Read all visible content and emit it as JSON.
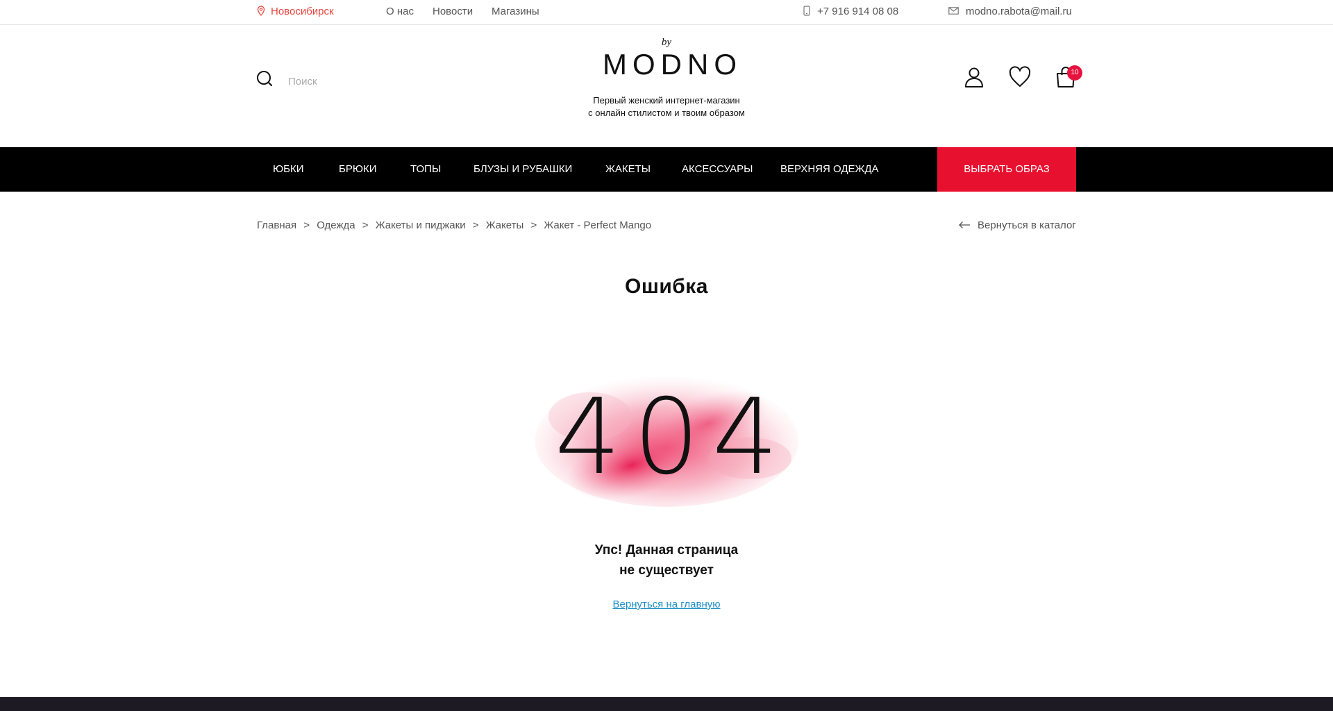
{
  "topbar": {
    "city": "Новосибирск",
    "links": [
      "О нас",
      "Новости",
      "Магазины"
    ],
    "phone": "+7 916 914 08 08",
    "email": "modno.rabota@mail.ru"
  },
  "header": {
    "search_placeholder": "Поиск",
    "logo_by": "by",
    "logo_brand": "MODNO",
    "tagline_line1": "Первый женский интернет-магазин",
    "tagline_line2": "с онлайн стилистом и твоим образом",
    "cart_count": "10"
  },
  "nav": {
    "items": [
      "ЮБКИ",
      "БРЮКИ",
      "ТОПЫ",
      "БЛУЗЫ И РУБАШКИ",
      "ЖАКЕТЫ",
      "АКСЕССУАРЫ",
      "ВЕРХНЯЯ ОДЕЖДА"
    ],
    "cta": "ВЫБРАТЬ ОБРАЗ"
  },
  "breadcrumb": {
    "items": [
      "Главная",
      "Одежда",
      "Жакеты и пиджаки",
      "Жакеты",
      "Жакет - Perfect Mango"
    ],
    "separator": ">",
    "back": "Вернуться в каталог"
  },
  "main": {
    "title": "Ошибка",
    "code": "404",
    "message_line1": "Упс! Данная страница",
    "message_line2": "не существует",
    "home_link": "Вернуться на главную"
  },
  "colors": {
    "accent": "#e8102f",
    "link": "#1c8fc7",
    "nav_bg": "#000000",
    "city": "#e8433e"
  },
  "icons": {
    "city": "map-pin-icon",
    "phone": "phone-icon",
    "email": "envelope-icon",
    "search": "search-icon",
    "user": "user-icon",
    "favorites": "heart-icon",
    "cart": "shopping-bag-icon",
    "back": "arrow-left-icon"
  }
}
